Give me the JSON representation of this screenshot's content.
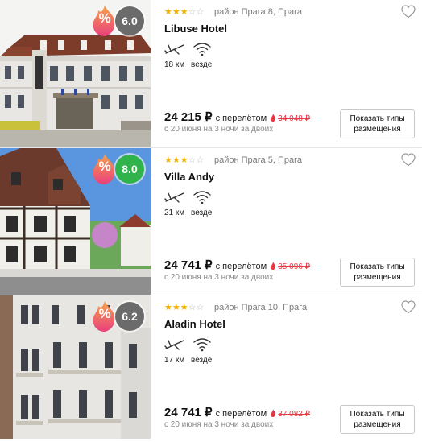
{
  "hotels": [
    {
      "name": "Libuse Hotel",
      "district": "район Прага 8, Прага",
      "stars": 3,
      "rating": "6.0",
      "rating_color": "#6b6b6b",
      "discount_symbol": "%",
      "distance": "18 км",
      "wifi": "везде",
      "price": "24 215 ₽",
      "with_flight": "с перелётом",
      "old_price": "34 048 ₽",
      "dates": "с 20 июня на 3 ночи за двоих",
      "button": "Показать типы размещения",
      "photo": "hotel-building-photo"
    },
    {
      "name": "Villa Andy",
      "district": "район Прага 5, Прага",
      "stars": 3,
      "rating": "8.0",
      "rating_color": "#2fb34a",
      "discount_symbol": "%",
      "distance": "21 км",
      "wifi": "везде",
      "price": "24 741 ₽",
      "with_flight": "с перелётом",
      "old_price": "35 096 ₽",
      "dates": "с 20 июня на 3 ночи за двоих",
      "button": "Показать типы размещения",
      "photo": "villa-photo"
    },
    {
      "name": "Aladin Hotel",
      "district": "район Прага 10, Прага",
      "stars": 3,
      "rating": "6.2",
      "rating_color": "#6b6b6b",
      "discount_symbol": "%",
      "distance": "17 км",
      "wifi": "везде",
      "price": "24 741 ₽",
      "with_flight": "с перелётом",
      "old_price": "37 082 ₽",
      "dates": "с 20 июня на 3 ночи за двоих",
      "button": "Показать типы размещения",
      "photo": "facade-photo"
    }
  ],
  "colors": {
    "star_on": "#f3b200",
    "star_off": "#bdbdbd",
    "old_price": "#e63946",
    "discount_gradient": [
      "#f6a24a",
      "#e9407d"
    ]
  }
}
